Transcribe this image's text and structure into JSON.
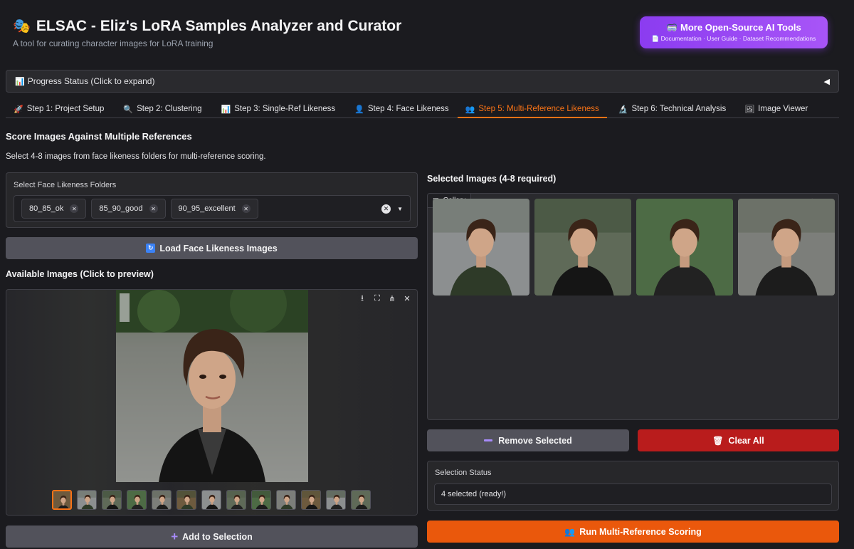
{
  "header": {
    "title_emoji": "🎭",
    "title": "ELSAC - Eliz's LoRA Samples Analyzer and Curator",
    "subtitle": "A tool for curating character images for LoRA training",
    "tools_button": {
      "icon": "🥽",
      "label": "More Open-Source AI Tools",
      "sub_icon": "📄",
      "sublabel": "Documentation · User Guide · Dataset Recommendations"
    }
  },
  "progress_accordion": {
    "icon": "📊",
    "label": "Progress Status (Click to expand)",
    "caret": "◀"
  },
  "tabs": [
    {
      "icon": "🚀",
      "label": "Step 1: Project Setup",
      "active": false
    },
    {
      "icon": "🔍",
      "label": "Step 2: Clustering",
      "active": false
    },
    {
      "icon": "📊",
      "label": "Step 3: Single-Ref Likeness",
      "active": false
    },
    {
      "icon": "👤",
      "label": "Step 4: Face Likeness",
      "active": false
    },
    {
      "icon": "👥",
      "label": "Step 5: Multi-Reference Likeness",
      "active": true
    },
    {
      "icon": "🔬",
      "label": "Step 6: Technical Analysis",
      "active": false
    },
    {
      "icon": "🖼",
      "label": "Image Viewer",
      "active": false
    }
  ],
  "main": {
    "title": "Score Images Against Multiple References",
    "description": "Select 4-8 images from face likeness folders for multi-reference scoring.",
    "folders": {
      "label": "Select Face Likeness Folders",
      "selected": [
        "80_85_ok",
        "85_90_good",
        "90_95_excellent"
      ]
    },
    "load_button": {
      "icon": "🔄",
      "label": "Load Face Likeness Images"
    },
    "available": {
      "title": "Available Images (Click to preview)",
      "thumbnail_count": 13,
      "selected_index": 0
    },
    "add_button": {
      "label": "Add to Selection"
    }
  },
  "selection": {
    "title": "Selected Images (4-8 required)",
    "gallery_label": "Gallery",
    "image_count": 4,
    "remove_button": {
      "label": "Remove Selected"
    },
    "clear_button": {
      "icon": "🗑",
      "label": "Clear All"
    },
    "status": {
      "label": "Selection Status",
      "value": "4 selected (ready!)"
    },
    "run_button": {
      "icon": "👥",
      "label": "Run Multi-Reference Scoring"
    }
  },
  "colors": {
    "accent": "#f97316",
    "purple": "#a855f7",
    "danger": "#b91c1c",
    "run": "#ea580c",
    "background": "#1b1b1f"
  }
}
